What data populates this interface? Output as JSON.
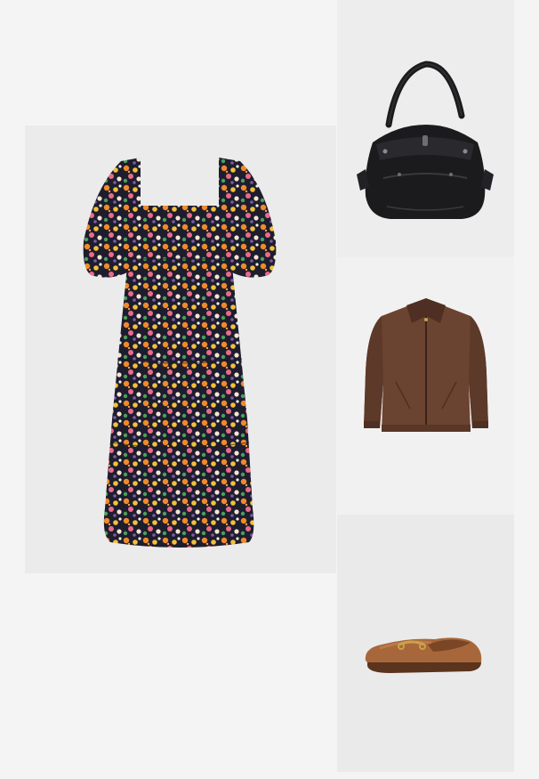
{
  "outfit": {
    "items": [
      {
        "icon": "dress-floral-icon",
        "colors": {
          "base": "#1e1d2e",
          "flowers": [
            "#f08a2a",
            "#f3c03b",
            "#e96b8a",
            "#f7e4d4",
            "#4aa05c",
            "#7d5aa6",
            "#f4f0e6"
          ]
        }
      },
      {
        "icon": "handbag-black-icon",
        "colors": {
          "leather": "#1b1b1d",
          "highlight": "#3a3a3e"
        }
      },
      {
        "icon": "jacket-brown-icon",
        "colors": {
          "fabric": "#6b4331",
          "shade": "#4f2f23"
        }
      },
      {
        "icon": "loafer-tan-icon",
        "colors": {
          "leather": "#a8673a",
          "sole": "#5a341c",
          "hardware": "#c9a24a"
        }
      }
    ]
  }
}
